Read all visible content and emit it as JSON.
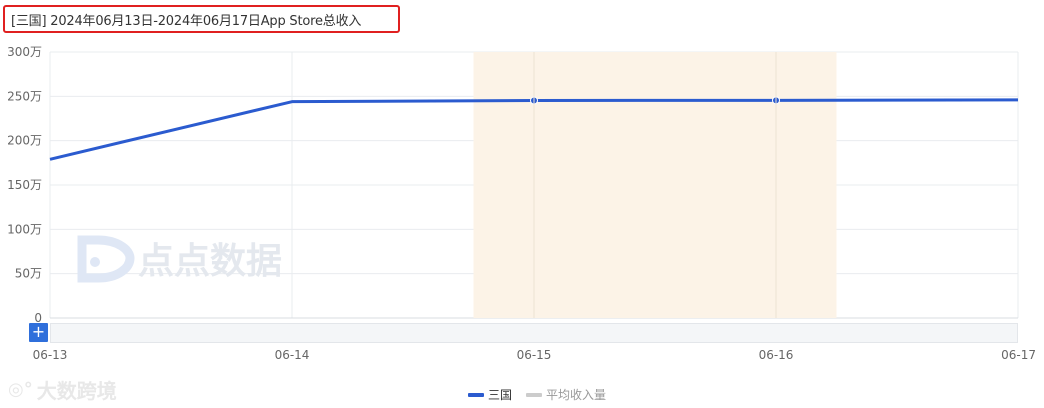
{
  "title": "[三国]  2024年06月13日-2024年06月17日App Store总收入",
  "colors": {
    "series_line": "#2b5bcf",
    "highlight_band": "#fcf3e7",
    "grid": "#e9ecef",
    "title_border": "#e02020",
    "average_legend": "#cccccc"
  },
  "chart_data": {
    "type": "line",
    "x": [
      "06-13",
      "06-14",
      "06-15",
      "06-16",
      "06-17"
    ],
    "series": [
      {
        "name": "三国",
        "values": [
          1790000,
          2440000,
          2453000,
          2455000,
          2460000
        ]
      }
    ],
    "y_ticks": [
      "0",
      "50万",
      "100万",
      "150万",
      "200万",
      "250万",
      "300万"
    ],
    "ylim": [
      0,
      3000000
    ],
    "grid": true,
    "legend_position": "bottom-center",
    "legend": [
      "三国",
      "平均收入量"
    ]
  },
  "watermark": {
    "center_text": "点点数据",
    "footer_text": "大数跨境"
  },
  "zoom": {
    "plus_label": "+"
  }
}
